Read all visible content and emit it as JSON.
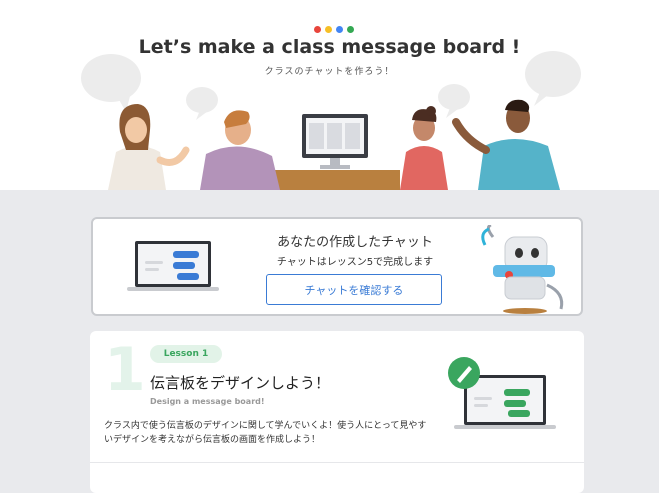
{
  "hero": {
    "title": "Let’s make a class message board !",
    "subtitle": "クラスのチャットを作ろう！",
    "dot_colors": [
      "#e8453c",
      "#f6bf26",
      "#4285f4",
      "#34a853"
    ]
  },
  "chat_card": {
    "title": "あなたの作成したチャット",
    "subtitle": "チャットはレッスン5で完成します",
    "button_label": "チャットを確認する"
  },
  "lesson": {
    "number": "1",
    "badge": "Lesson 1",
    "title": "伝言板をデザインしよう！",
    "subtitle": "Design a message board!",
    "description": "クラス内で使う伝言板のデザインに関して学んでいくよ！使う人にとって見やすいデザインを考えながら伝言板の画面を作成しよう！"
  },
  "colors": {
    "accent_blue": "#3a7bd5",
    "accent_green": "#3aa65f",
    "background": "#e9eaed"
  },
  "icons": [
    "speech-bubble-icon",
    "computer-monitor-icon",
    "robot-mascot-icon",
    "laptop-chat-icon",
    "pencil-icon"
  ]
}
